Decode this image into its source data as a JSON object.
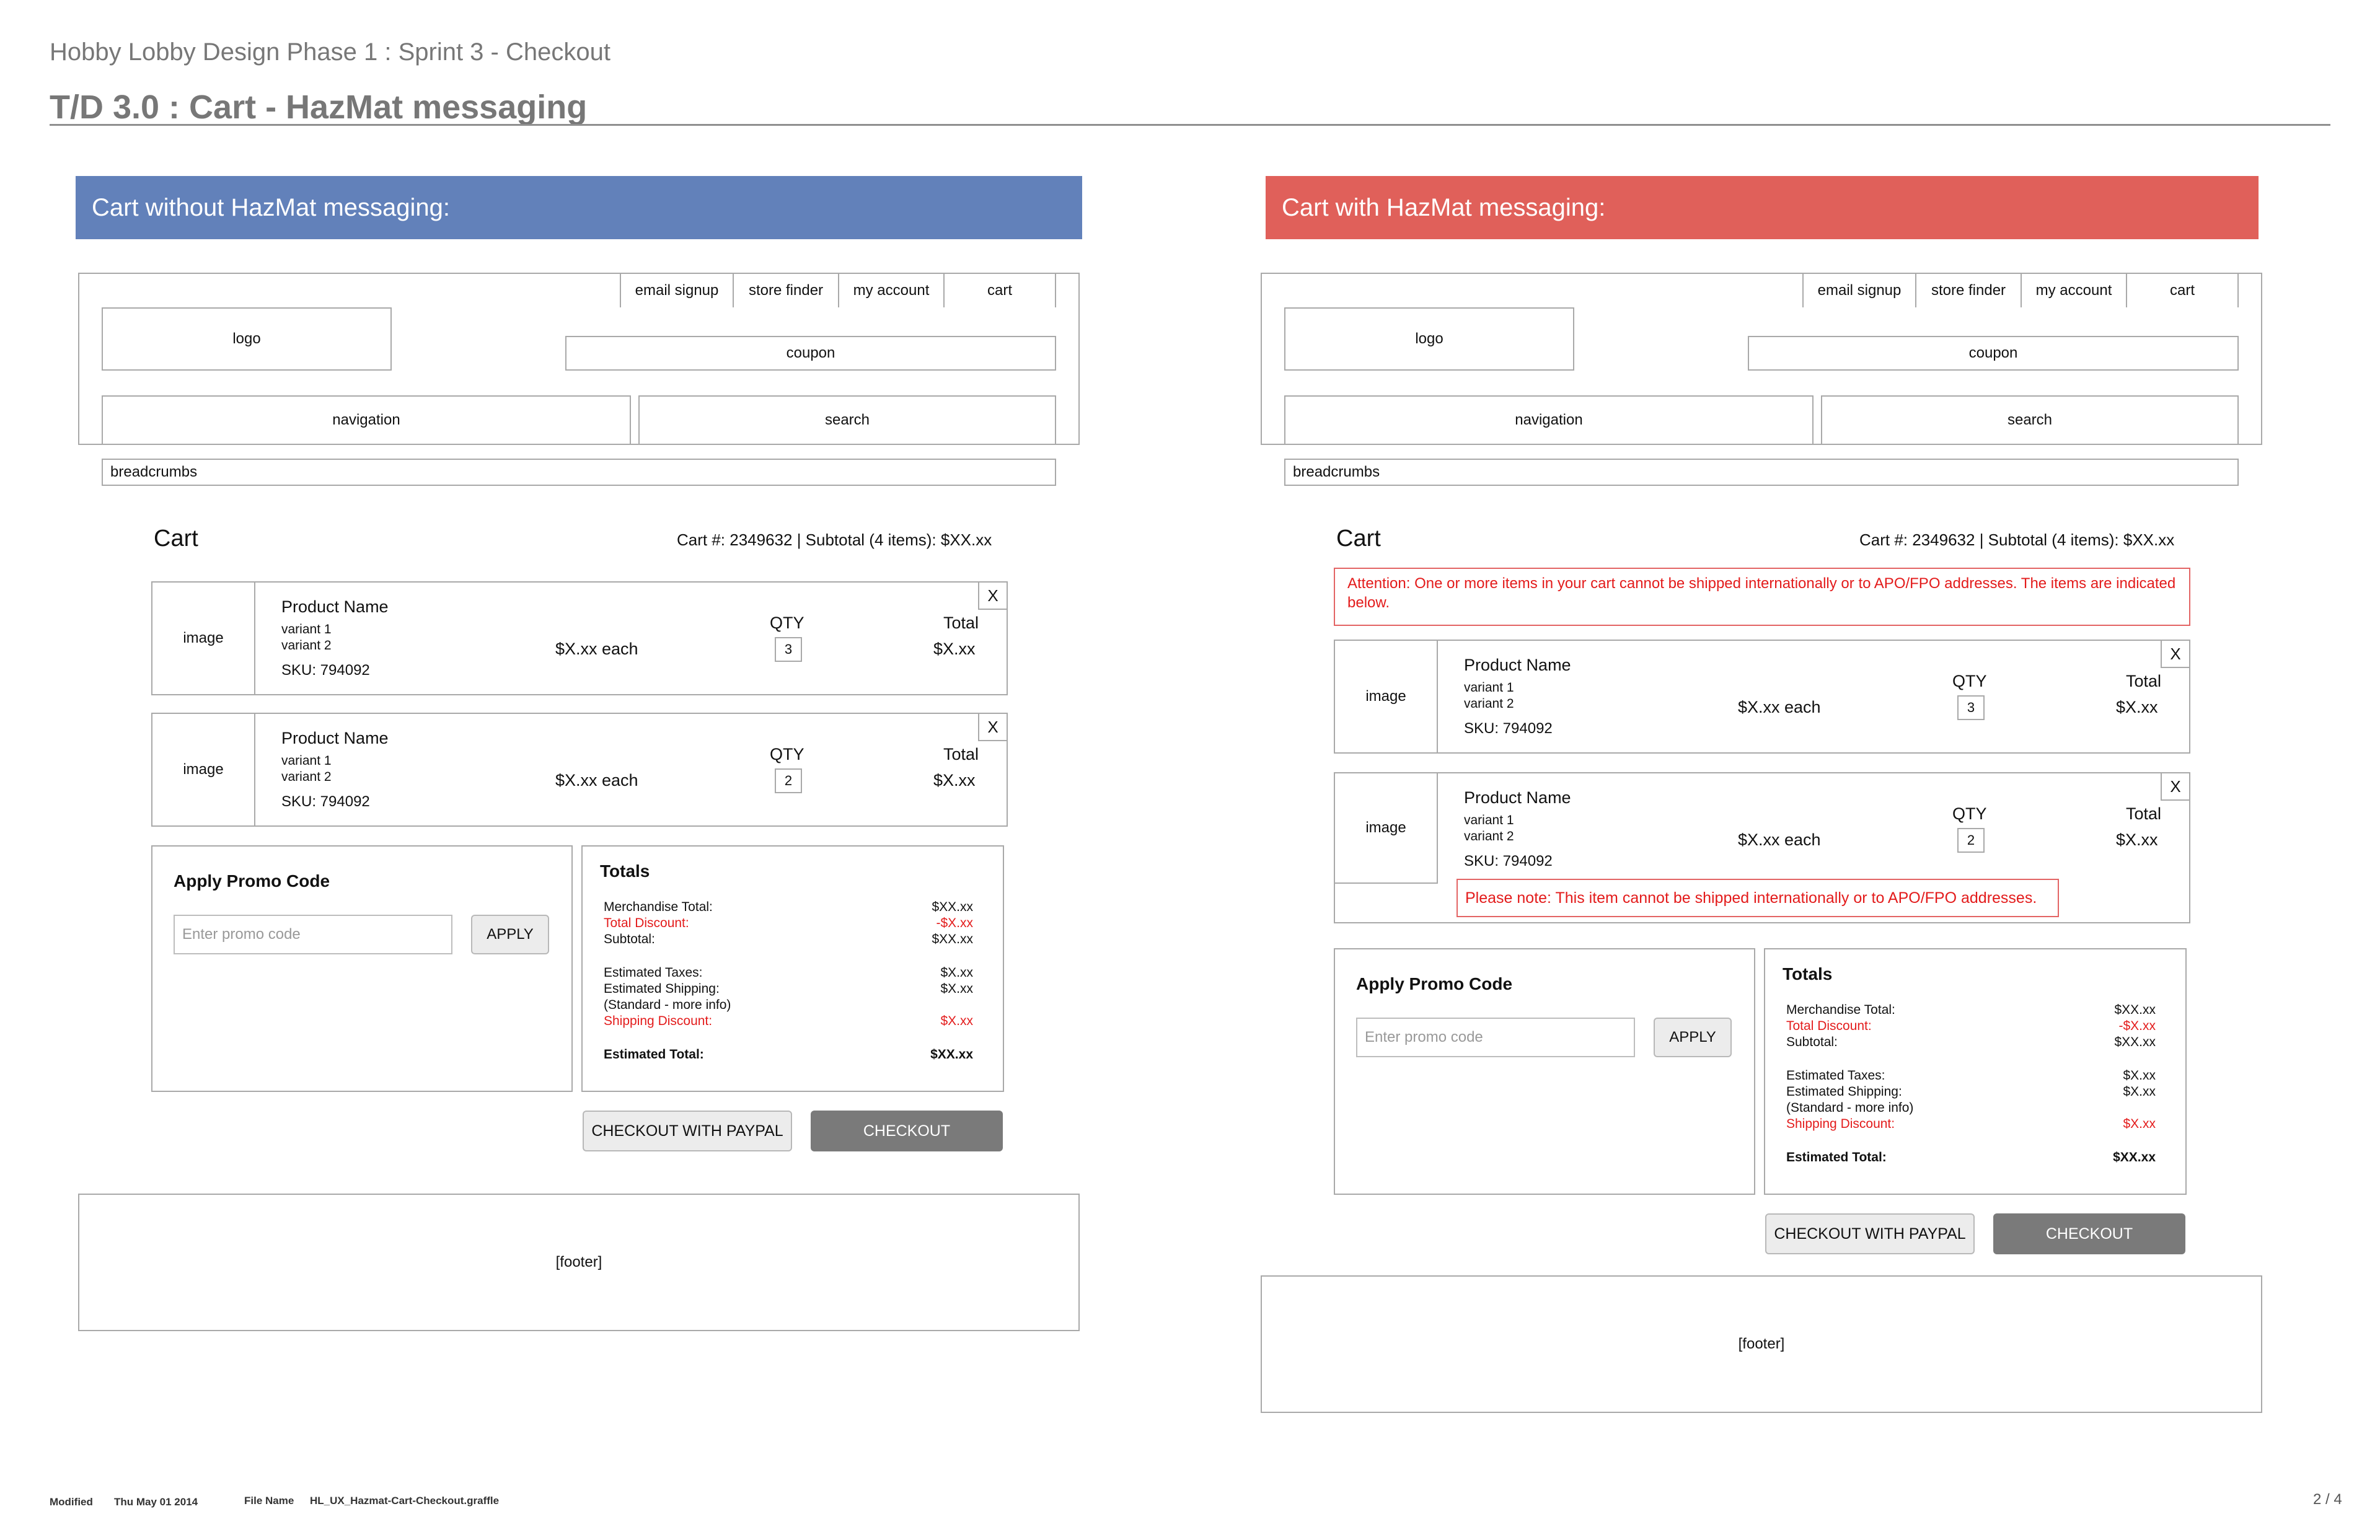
{
  "header": {
    "project_title": "Hobby Lobby Design Phase 1 : Sprint 3 - Checkout",
    "page_title": "T/D 3.0 : Cart - HazMat messaging"
  },
  "colors": {
    "left_banner": "#6281ba",
    "right_banner": "#e0605a",
    "error_red": "#e31b1b"
  },
  "panels": [
    {
      "banner": "Cart without HazMat messaging:",
      "top_nav": [
        "email signup",
        "store finder",
        "my account",
        "cart"
      ],
      "logo": "logo",
      "coupon": "coupon",
      "navigation": "navigation",
      "search": "search",
      "breadcrumbs": "breadcrumbs",
      "cart_title": "Cart",
      "cart_meta": "Cart #: 2349632  |  Subtotal (4 items): $XX.xx",
      "items": [
        {
          "image": "image",
          "name": "Product Name",
          "variant1": "variant 1",
          "variant2": "variant 2",
          "sku": "SKU: 794092",
          "each": "$X.xx each",
          "qty_label": "QTY",
          "qty": "3",
          "total_label": "Total",
          "total": "$X.xx",
          "remove": "X"
        },
        {
          "image": "image",
          "name": "Product Name",
          "variant1": "variant 1",
          "variant2": "variant 2",
          "sku": "SKU: 794092",
          "each": "$X.xx each",
          "qty_label": "QTY",
          "qty": "2",
          "total_label": "Total",
          "total": "$X.xx",
          "remove": "X"
        }
      ],
      "promo": {
        "title": "Apply Promo Code",
        "placeholder": "Enter promo code",
        "apply": "APPLY"
      },
      "totals": {
        "title": "Totals",
        "merch_label": "Merchandise Total:",
        "merch": "$XX.xx",
        "discount_label": "Total Discount:",
        "discount": "-$X.xx",
        "subtotal_label": "Subtotal:",
        "subtotal": "$XX.xx",
        "taxes_label": "Estimated Taxes:",
        "taxes": "$X.xx",
        "shipping_label": "Estimated Shipping:",
        "shipping": "$X.xx",
        "shipping_note": "(Standard - more info)",
        "ship_discount_label": "Shipping Discount:",
        "ship_discount": "$X.xx",
        "est_total_label": "Estimated Total:",
        "est_total": "$XX.xx"
      },
      "paypal": "CHECKOUT WITH PAYPAL",
      "checkout": "CHECKOUT",
      "footer": "[footer]"
    },
    {
      "banner": "Cart with HazMat messaging:",
      "top_nav": [
        "email signup",
        "store finder",
        "my account",
        "cart"
      ],
      "logo": "logo",
      "coupon": "coupon",
      "navigation": "navigation",
      "search": "search",
      "breadcrumbs": "breadcrumbs",
      "cart_title": "Cart",
      "cart_meta": "Cart #: 2349632  |  Subtotal (4 items): $XX.xx",
      "attention": "Attention: One or more items in your cart cannot be shipped internationally or to APO/FPO addresses. The items are indicated below.",
      "items": [
        {
          "image": "image",
          "name": "Product Name",
          "variant1": "variant 1",
          "variant2": "variant 2",
          "sku": "SKU: 794092",
          "each": "$X.xx each",
          "qty_label": "QTY",
          "qty": "3",
          "total_label": "Total",
          "total": "$X.xx",
          "remove": "X"
        },
        {
          "image": "image",
          "name": "Product Name",
          "variant1": "variant 1",
          "variant2": "variant 2",
          "sku": "SKU: 794092",
          "each": "$X.xx each",
          "qty_label": "QTY",
          "qty": "2",
          "total_label": "Total",
          "total": "$X.xx",
          "remove": "X",
          "note": "Please note: This item cannot be shipped internationally or to APO/FPO addresses."
        }
      ],
      "promo": {
        "title": "Apply Promo Code",
        "placeholder": "Enter promo code",
        "apply": "APPLY"
      },
      "totals": {
        "title": "Totals",
        "merch_label": "Merchandise Total:",
        "merch": "$XX.xx",
        "discount_label": "Total Discount:",
        "discount": "-$X.xx",
        "subtotal_label": "Subtotal:",
        "subtotal": "$XX.xx",
        "taxes_label": "Estimated Taxes:",
        "taxes": "$X.xx",
        "shipping_label": "Estimated Shipping:",
        "shipping": "$X.xx",
        "shipping_note": "(Standard - more info)",
        "ship_discount_label": "Shipping Discount:",
        "ship_discount": "$X.xx",
        "est_total_label": "Estimated Total:",
        "est_total": "$XX.xx"
      },
      "paypal": "CHECKOUT WITH PAYPAL",
      "checkout": "CHECKOUT",
      "footer": "[footer]"
    }
  ],
  "footer_meta": {
    "modified_label": "Modified",
    "modified_value": "Thu May 01 2014",
    "file_label": "File Name",
    "file_value": "HL_UX_Hazmat-Cart-Checkout.graffle",
    "page": "2 / 4"
  }
}
